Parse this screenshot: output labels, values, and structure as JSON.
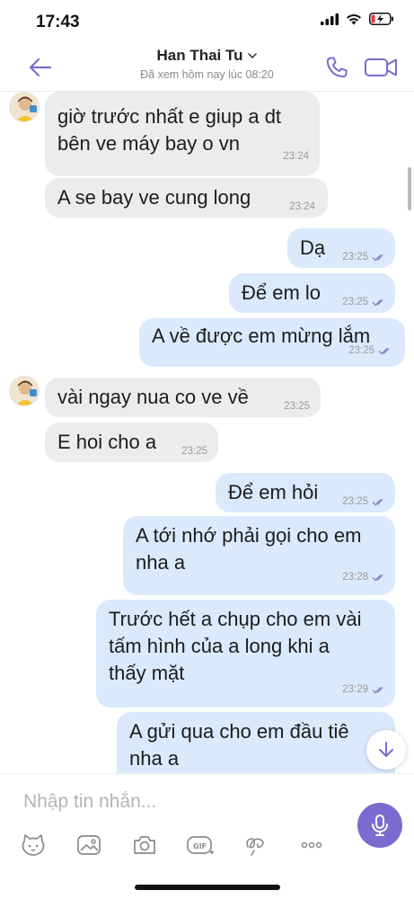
{
  "status_bar": {
    "time": "17:43"
  },
  "header": {
    "contact_name": "Han Thai Tu",
    "last_seen": "Đã xem hôm nay lúc 08:20"
  },
  "messages": [
    {
      "dir": "in",
      "text_lines": [
        "giờ trước nhất e giup a dt",
        "bên ve máy bay o vn"
      ],
      "time": "23:24"
    },
    {
      "dir": "in",
      "text_lines": [
        "A se bay ve cung long"
      ],
      "time": "23:24"
    },
    {
      "dir": "out",
      "text_lines": [
        "Dạ"
      ],
      "time": "23:25"
    },
    {
      "dir": "out",
      "text_lines": [
        "Để em lo"
      ],
      "time": "23:25"
    },
    {
      "dir": "out",
      "text_lines": [
        "A về được em mừng lắm"
      ],
      "time": "23:25"
    },
    {
      "dir": "in",
      "text_lines": [
        "vài ngay nua co ve về"
      ],
      "time": "23:25"
    },
    {
      "dir": "in",
      "text_lines": [
        "E hoi cho a"
      ],
      "time": "23:25"
    },
    {
      "dir": "out",
      "text_lines": [
        "Để em hỏi"
      ],
      "time": "23:25"
    },
    {
      "dir": "out",
      "text_lines": [
        "A tới nhớ phải gọi cho em",
        "nha a"
      ],
      "time": "23:28"
    },
    {
      "dir": "out",
      "text_lines": [
        "Trước hết a chụp cho em vài",
        "tấm hình của a long khi a",
        "thấy mặt"
      ],
      "time": "23:29"
    },
    {
      "dir": "out",
      "text_lines": [
        "A gửi qua cho em đầu tiê",
        "nha a"
      ],
      "time": ""
    }
  ],
  "composer": {
    "placeholder": "Nhập tin nhắn..."
  },
  "toolbar_icons": [
    "sticker-icon",
    "gallery-icon",
    "camera-icon",
    "gif-icon",
    "doodle-icon",
    "more-icon"
  ],
  "colors": {
    "accent": "#7b6bd0",
    "incoming_bubble": "#ececed",
    "outgoing_bubble": "#dbe9fd",
    "tick": "#8c86c9"
  }
}
